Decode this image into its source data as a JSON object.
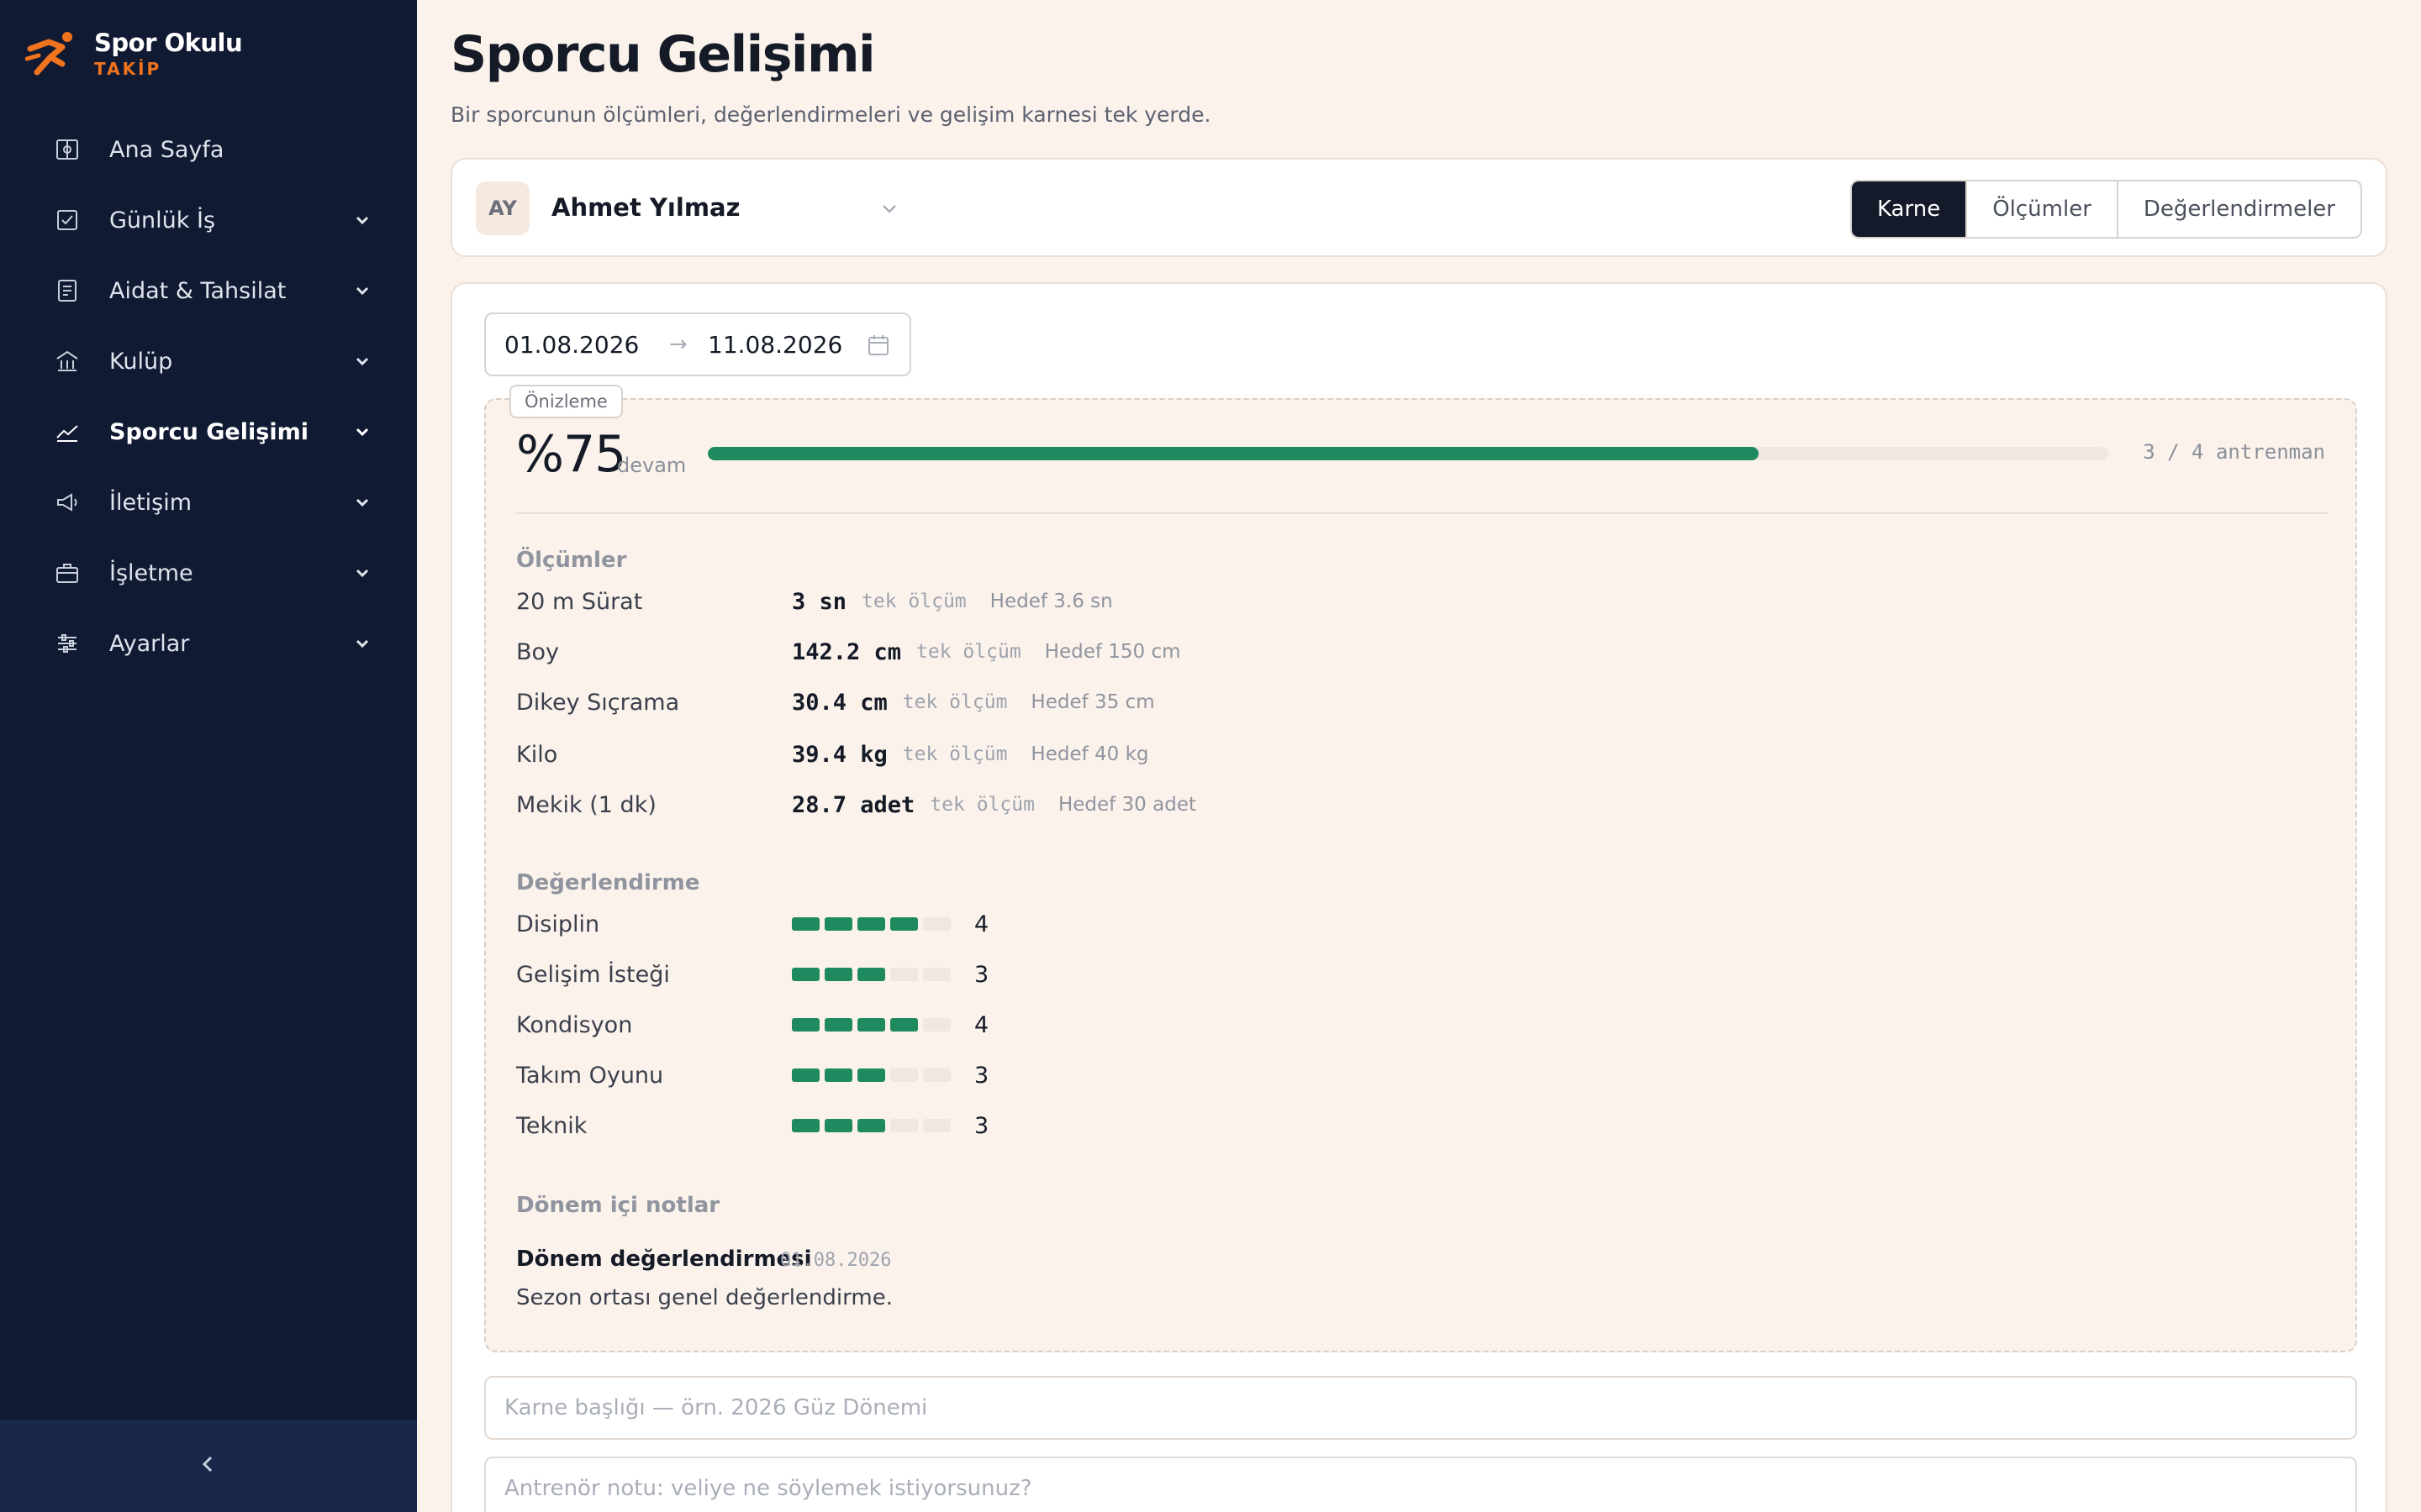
{
  "brand": {
    "name": "Spor Okulu",
    "sub": "TAKİP",
    "accent": "#f0731e"
  },
  "sidebar": {
    "items": [
      {
        "label": "Ana Sayfa",
        "icon": "dashboard-icon",
        "expandable": false
      },
      {
        "label": "Günlük İş",
        "icon": "checkbox-icon",
        "expandable": true
      },
      {
        "label": "Aidat & Tahsilat",
        "icon": "receipt-icon",
        "expandable": true
      },
      {
        "label": "Kulüp",
        "icon": "building-icon",
        "expandable": true
      },
      {
        "label": "Sporcu Gelişimi",
        "icon": "chart-line-icon",
        "expandable": true,
        "active": true
      },
      {
        "label": "İletişim",
        "icon": "megaphone-icon",
        "expandable": true
      },
      {
        "label": "İşletme",
        "icon": "briefcase-icon",
        "expandable": true
      },
      {
        "label": "Ayarlar",
        "icon": "sliders-icon",
        "expandable": true
      }
    ],
    "collapse_icon": "chevron-left-icon"
  },
  "page": {
    "title": "Sporcu Gelişimi",
    "subtitle": "Bir sporcunun ölçümleri, değerlendirmeleri ve gelişim karnesi tek yerde."
  },
  "athlete": {
    "initials": "AY",
    "name": "Ahmet Yılmaz"
  },
  "tabs": [
    "Karne",
    "Ölçümler",
    "Değerlendirmeler"
  ],
  "active_tab": "Karne",
  "date_range": {
    "start": "01.08.2026",
    "arrow": "→",
    "end": "11.08.2026"
  },
  "preview": {
    "badge": "Önizleme",
    "attendance_pct": "%75",
    "attendance_label": "devam",
    "attendance_fraction": 0.75,
    "attendance_count": "3 / 4 antrenman",
    "measurements_title": "Ölçümler",
    "measurements": [
      {
        "label": "20 m Sürat",
        "value": "3 sn",
        "tag": "tek ölçüm",
        "target": "Hedef 3.6 sn"
      },
      {
        "label": "Boy",
        "value": "142.2 cm",
        "tag": "tek ölçüm",
        "target": "Hedef 150 cm"
      },
      {
        "label": "Dikey Sıçrama",
        "value": "30.4 cm",
        "tag": "tek ölçüm",
        "target": "Hedef 35 cm"
      },
      {
        "label": "Kilo",
        "value": "39.4 kg",
        "tag": "tek ölçüm",
        "target": "Hedef 40 kg"
      },
      {
        "label": "Mekik (1 dk)",
        "value": "28.7 adet",
        "tag": "tek ölçüm",
        "target": "Hedef 30 adet"
      }
    ],
    "evaluation_title": "Değerlendirme",
    "evaluation_max": 5,
    "evaluations": [
      {
        "label": "Disiplin",
        "score": 4
      },
      {
        "label": "Gelişim İsteği",
        "score": 3
      },
      {
        "label": "Kondisyon",
        "score": 4
      },
      {
        "label": "Takım Oyunu",
        "score": 3
      },
      {
        "label": "Teknik",
        "score": 3
      }
    ],
    "notes_title": "Dönem içi notlar",
    "notes": [
      {
        "title": "Dönem değerlendirmesi",
        "date": "01.08.2026",
        "text": "Sezon ortası genel değerlendirme."
      }
    ]
  },
  "form": {
    "title_placeholder": "Karne başlığı — örn. 2026 Güz Dönemi",
    "note_placeholder": "Antrenör notu: veliye ne söylemek istiyorsunuz?"
  },
  "colors": {
    "sidebar_bg": "#111a33",
    "progress": "#1f8a5f",
    "page_bg": "#fbf2ec"
  }
}
